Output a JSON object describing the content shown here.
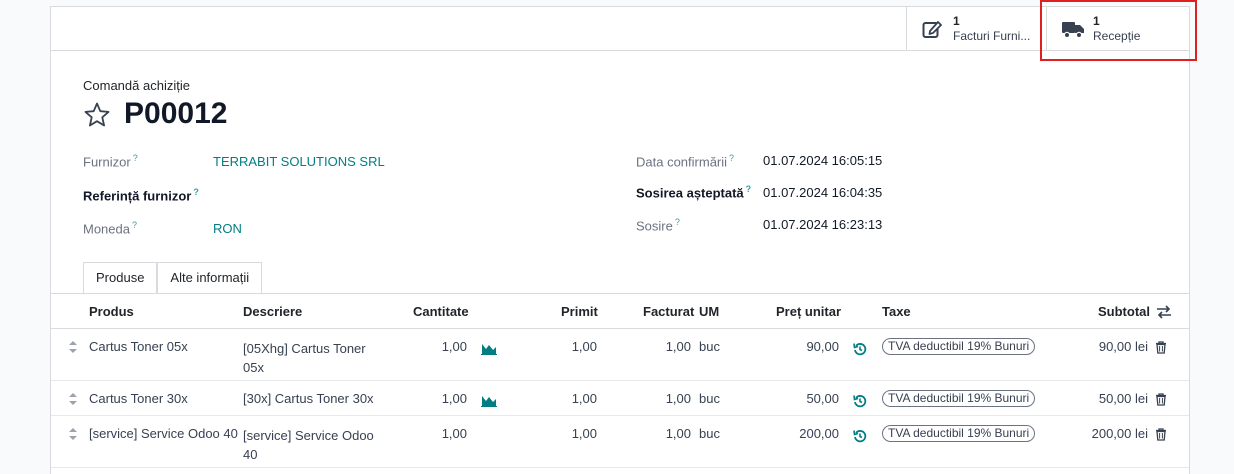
{
  "buttons": {
    "facturi": {
      "count": "1",
      "label": "Facturi Furni..."
    },
    "receptie": {
      "count": "1",
      "label": "Recepție"
    }
  },
  "header": {
    "doc_type": "Comandă achiziție",
    "name": "P00012"
  },
  "fields": {
    "furnizor_label": "Furnizor",
    "furnizor_value": "TERRABIT SOLUTIONS SRL",
    "referinta_label": "Referință furnizor",
    "moneda_label": "Moneda",
    "moneda_value": "RON",
    "data_confirmarii_label": "Data confirmării",
    "data_confirmarii_value": "01.07.2024 16:05:15",
    "sosirea_asteptata_label": "Sosirea așteptată",
    "sosirea_asteptata_value": "01.07.2024 16:04:35",
    "sosire_label": "Sosire",
    "sosire_value": "01.07.2024 16:23:13",
    "help_mark": "?"
  },
  "tabs": [
    "Produse",
    "Alte informații"
  ],
  "table": {
    "columns": {
      "produs": "Produs",
      "descriere": "Descriere",
      "cantitate": "Cantitate",
      "primit": "Primit",
      "facturat": "Facturat",
      "um": "UM",
      "pret": "Preț unitar",
      "taxe": "Taxe",
      "subtotal": "Subtotal"
    },
    "rows": [
      {
        "produs": "Cartus Toner 05x",
        "descriere1": "[05Xhg] Cartus Toner",
        "descriere2": "05x",
        "cantitate": "1,00",
        "primit": "1,00",
        "facturat": "1,00",
        "um": "buc",
        "pret": "90,00",
        "taxe": "TVA deductibil 19% Bunuri",
        "subtotal": "90,00 lei"
      },
      {
        "produs": "Cartus Toner 30x",
        "descriere1": "[30x] Cartus Toner 30x",
        "descriere2": "",
        "cantitate": "1,00",
        "primit": "1,00",
        "facturat": "1,00",
        "um": "buc",
        "pret": "50,00",
        "taxe": "TVA deductibil 19% Bunuri",
        "subtotal": "50,00 lei"
      },
      {
        "produs": "[service] Service Odoo 40",
        "descriere1": "[service] Service Odoo",
        "descriere2": "40",
        "cantitate": "1,00",
        "primit": "1,00",
        "facturat": "1,00",
        "um": "buc",
        "pret": "200,00",
        "taxe": "TVA deductibil 19% Bunuri",
        "subtotal": "200,00 lei"
      }
    ]
  },
  "colors": {
    "link": "#017e84",
    "highlight": "#e02020"
  }
}
